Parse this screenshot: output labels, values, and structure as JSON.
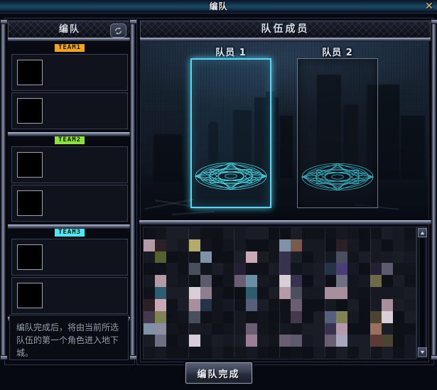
{
  "window": {
    "title": "编队",
    "close_icon": "close-x-icon"
  },
  "left_panel": {
    "header_title": "编队",
    "swap_icon": "swap-refresh-icon",
    "teams": [
      {
        "tag": "TEAM1",
        "color": "#f5a317",
        "slots": [
          {
            "avatar": ""
          },
          {
            "avatar": ""
          }
        ]
      },
      {
        "tag": "TEAM2",
        "color": "#8ce337",
        "slots": [
          {
            "avatar": ""
          },
          {
            "avatar": ""
          }
        ]
      },
      {
        "tag": "TEAM3",
        "color": "#49e8f2",
        "slots": [
          {
            "avatar": ""
          },
          {
            "avatar": ""
          }
        ]
      }
    ],
    "hint": "编队完成后，将由当前所选队伍的第一个角色进入地下城。"
  },
  "right_panel": {
    "header_title": "队伍成员",
    "members": [
      {
        "label": "队员 1",
        "state": "selected",
        "circle_icon": "magic-circle-icon"
      },
      {
        "label": "队员 2",
        "state": "empty",
        "circle_icon": "magic-circle-icon"
      }
    ],
    "roster": {
      "scroll_up_icon": "scroll-up-arrow-icon",
      "scroll_down_icon": "scroll-down-arrow-icon"
    }
  },
  "footer": {
    "confirm_label": "编队完成"
  },
  "colors": {
    "accent_cyan": "#56d8f5",
    "title_blue": "#1a4a66",
    "close_gold": "#e8c15a",
    "frame_steel": "#8890a8"
  }
}
